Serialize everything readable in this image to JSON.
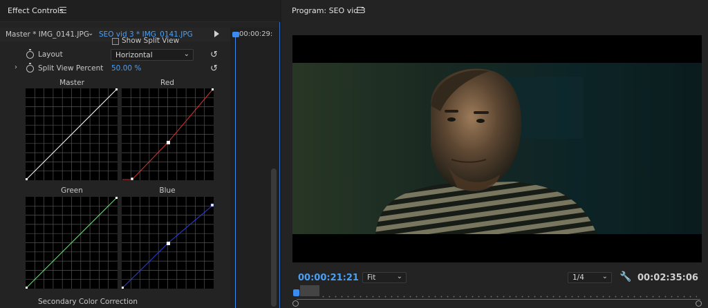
{
  "effect_controls": {
    "title": "Effect Controls",
    "clip_master": "Master * IMG_0141.JPG",
    "clip_sequence": "SEO vid 3 * IMG_0141.JPG",
    "timeline_time": "00:00:29:",
    "show_split_view_label": "Show Split View",
    "layout_label": "Layout",
    "layout_value": "Horizontal",
    "split_view_percent_label": "Split View Percent",
    "split_view_percent_value": "50.00 %",
    "curves": [
      {
        "title": "Master",
        "color": "#ffffff"
      },
      {
        "title": "Red",
        "color": "#e03030"
      },
      {
        "title": "Green",
        "color": "#7ee07e"
      },
      {
        "title": "Blue",
        "color": "#2d3fe0"
      }
    ],
    "secondary_color_correction_label": "Secondary Color Correction"
  },
  "program_monitor": {
    "title": "Program: SEO vid 3",
    "current_timecode": "00:00:21:21",
    "zoom_value": "Fit",
    "resolution_value": "1/4",
    "duration_timecode": "00:02:35:06"
  },
  "colors": {
    "accent_blue": "#4a9ff5",
    "playhead_blue": "#3b8cf0",
    "panel_bg": "#232323"
  }
}
